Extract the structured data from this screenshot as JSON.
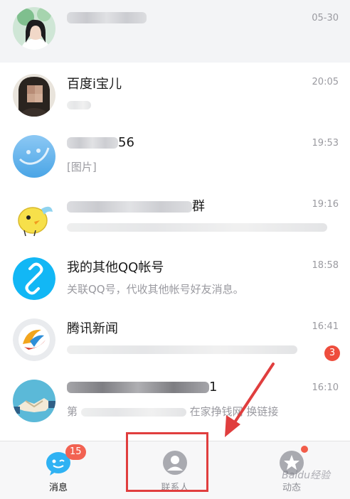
{
  "chats": [
    {
      "title": "",
      "preview": "",
      "time": "05-30",
      "badge": ""
    },
    {
      "title": "百度i宝儿",
      "preview": "",
      "time": "20:05",
      "badge": ""
    },
    {
      "title": "56",
      "preview": "[图片]",
      "time": "19:53",
      "badge": ""
    },
    {
      "title": "群",
      "preview": "",
      "time": "19:16",
      "badge": ""
    },
    {
      "title": "我的其他QQ帐号",
      "preview": "关联QQ号，代收其他帐号好友消息。",
      "time": "18:58",
      "badge": ""
    },
    {
      "title": "腾讯新闻",
      "preview": "",
      "time": "16:41",
      "badge": "3"
    },
    {
      "title": "1",
      "preview": "在家挣钱网 换链接",
      "preview_prefix": "第",
      "time": "16:10",
      "badge": ""
    }
  ],
  "tabs": [
    {
      "label": "消息",
      "badge": "15"
    },
    {
      "label": "联系人",
      "badge": ""
    },
    {
      "label": "动态",
      "badge": ""
    }
  ],
  "watermark": "Baidu经验",
  "colors": {
    "accent": "#12b7f5",
    "badge": "#ee4d3d",
    "annotation": "#e03e3e"
  }
}
